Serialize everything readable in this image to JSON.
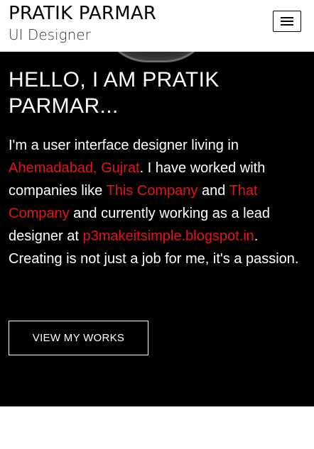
{
  "header": {
    "name": "PRATIK PARMAR",
    "role": "UI Designer",
    "menu_icon": "hamburger-menu-icon"
  },
  "hero": {
    "headline": "HELLO, I AM PRATIK PARMAR...",
    "bio": {
      "t1": "I'm a user interface designer living in ",
      "link_location": "Ahemadabad, Gujrat",
      "t2": ". I have worked with companies like ",
      "link_company_1": "This Company",
      "t3": " and ",
      "link_company_2": "That Company",
      "t4": " and currently working as a lead designer at ",
      "link_blog": "p3makeitsimple.blogspot.in",
      "t5": ". Creating is not just a job for me, it's a passion."
    },
    "cta_label": "VIEW MY WORKS"
  },
  "colors": {
    "hero_background": "#000000",
    "link_accent": "#e0141e",
    "header_background": "#ffffff"
  }
}
